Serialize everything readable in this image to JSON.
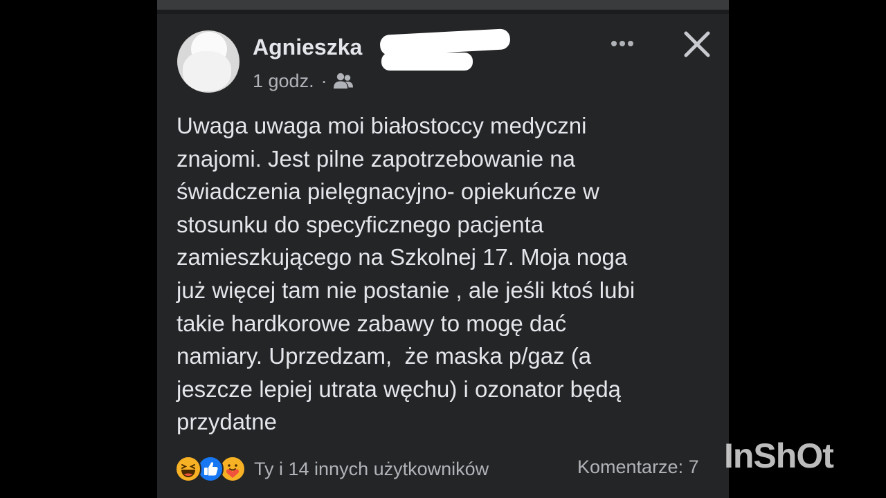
{
  "post": {
    "author": {
      "name": "Agnieszka"
    },
    "meta": {
      "time": "1 godz.",
      "separator": "·",
      "audience_icon": "friends-icon"
    },
    "text_lines": [
      "Uwaga uwaga moi białostoccy medyczni",
      "znajomi. Jest pilne zapotrzebowanie na",
      "świadczenia pielęgnacyjno- opiekuńcze w",
      "stosunku do specyficznego pacjenta",
      "zamieszkującego na Szkolnej 17. Moja noga",
      "już więcej tam nie postanie , ale jeśli ktoś lubi",
      "takie hardkorowe zabawy to mogę dać",
      "namiary. Uprzedzam,  że maska p/gaz (a",
      "jeszcze lepiej utrata węchu) i ozonator będą",
      "przydatne"
    ],
    "reactions": {
      "icons": [
        "haha-reaction-icon",
        "like-reaction-icon",
        "care-reaction-icon"
      ],
      "summary": "Ty i 14 innych użytkowników"
    },
    "comments": {
      "label": "Komentarze: 7"
    }
  },
  "header_actions": {
    "more_icon": "more-options-icon",
    "close_icon": "close-icon"
  },
  "watermark": {
    "text": "InShOt"
  },
  "colors": {
    "background": "#000000",
    "card": "#242526",
    "primary_text": "#e4e6eb",
    "secondary_text": "#b0b3b8",
    "like_blue": "#1877f2",
    "reaction_yellow": "#f7b125"
  }
}
